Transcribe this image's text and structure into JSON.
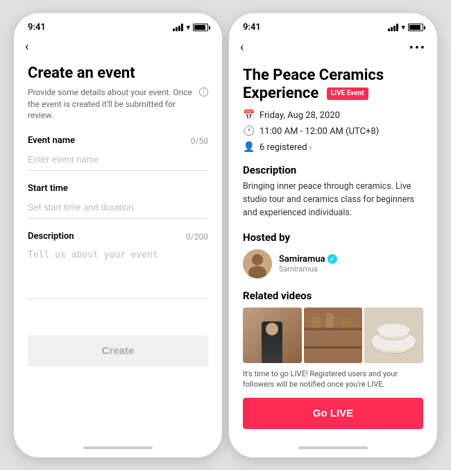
{
  "left_phone": {
    "status_time": "9:41",
    "nav": {
      "back_label": "‹"
    },
    "page_title": "Create an event",
    "page_subtitle": "Provide some details about your event. Once the event is created it'll be submitted for review.",
    "form": {
      "event_name_label": "Event name",
      "event_name_counter": "0/50",
      "event_name_placeholder": "Enter event name",
      "start_time_label": "Start time",
      "start_time_placeholder": "Set start time and duration",
      "description_label": "Description",
      "description_counter": "0/200",
      "description_placeholder": "Tell us about your event",
      "create_button": "Create"
    }
  },
  "right_phone": {
    "status_time": "9:41",
    "nav": {
      "back_label": "‹",
      "more_label": "•••"
    },
    "event_title": "The Peace Ceramics Experience",
    "live_badge": "LIVE Event",
    "date": "Friday, Aug 28, 2020",
    "time": "11:00 AM - 12:00 AM (UTC+8)",
    "registered": "6 registered",
    "description_title": "Description",
    "description_text": "Bringing inner peace through ceramics. Live studio tour and ceramics class for beginners and experienced individuals.",
    "hosted_by_title": "Hosted by",
    "host_name": "Samiramua",
    "host_verified": "✓",
    "host_handle": "Samiramua",
    "related_videos_title": "Related videos",
    "go_live_notice": "It's time to go LIVE! Registered users and your followers will be notified once you're LIVE.",
    "go_live_button": "Go LIVE"
  }
}
